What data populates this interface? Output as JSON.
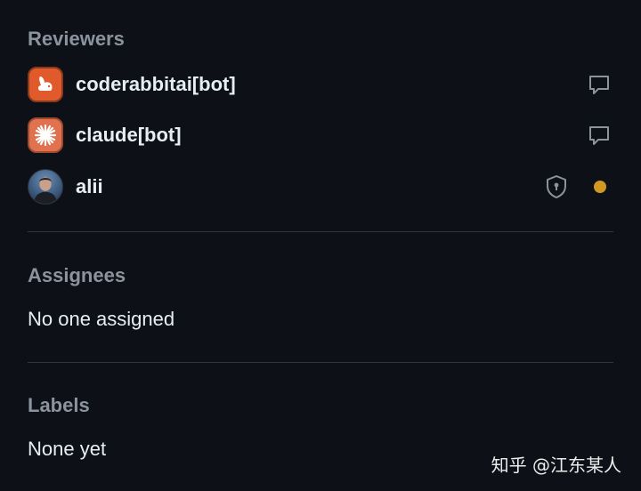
{
  "reviewers": {
    "title": "Reviewers",
    "items": [
      {
        "name": "coderabbitai[bot]",
        "avatar": "rabbit-avatar",
        "action_icon": "comment-icon"
      },
      {
        "name": "claude[bot]",
        "avatar": "claude-avatar",
        "action_icon": "comment-icon"
      },
      {
        "name": "alii",
        "avatar": "user-photo-avatar",
        "action_icon": "shield-lock-icon",
        "status": "pending",
        "status_color": "#d29922"
      }
    ]
  },
  "assignees": {
    "title": "Assignees",
    "value": "No one assigned"
  },
  "labels": {
    "title": "Labels",
    "value": "None yet"
  },
  "watermark": "知乎 @江东某人",
  "colors": {
    "background": "#0d1117",
    "text": "#e6edf3",
    "muted": "#8b949e",
    "divider": "#30363d",
    "pending": "#d29922"
  }
}
